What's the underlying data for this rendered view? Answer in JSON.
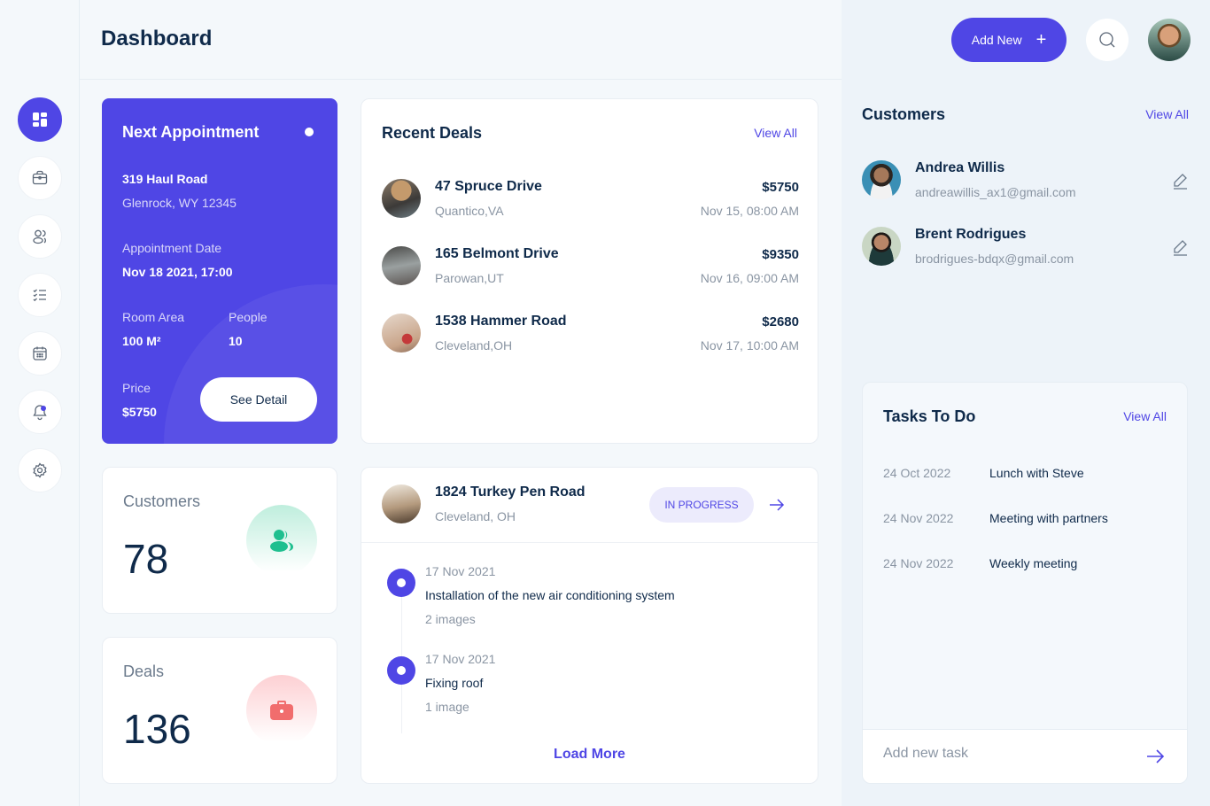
{
  "header": {
    "title": "Dashboard",
    "add_new_label": "Add New"
  },
  "sidebar": {
    "items": [
      {
        "name": "dashboard",
        "icon": "grid-icon",
        "active": true
      },
      {
        "name": "deals",
        "icon": "briefcase-icon",
        "active": false
      },
      {
        "name": "customers",
        "icon": "users-icon",
        "active": false
      },
      {
        "name": "tasks",
        "icon": "checklist-icon",
        "active": false
      },
      {
        "name": "calendar",
        "icon": "calendar-icon",
        "active": false
      },
      {
        "name": "notifications",
        "icon": "bell-icon",
        "active": false,
        "has_badge": true
      },
      {
        "name": "settings",
        "icon": "gear-icon",
        "active": false
      }
    ]
  },
  "appointment": {
    "title": "Next Appointment",
    "address_line1": "319 Haul  Road",
    "address_line2": "Glenrock,  WY  12345",
    "date_label": "Appointment Date",
    "date_value": "Nov 18 2021, 17:00",
    "room_area_label": "Room Area",
    "room_area_value": "100  M²",
    "people_label": "People",
    "people_value": "10",
    "price_label": "Price",
    "price_value": "$5750",
    "button_label": "See Detail"
  },
  "stats": {
    "customers": {
      "label": "Customers",
      "value": "78",
      "icon": "users-icon",
      "color": "#1fbf8f"
    },
    "deals": {
      "label": "Deals",
      "value": "136",
      "icon": "briefcase-icon",
      "color": "#f16d6d"
    }
  },
  "recent_deals": {
    "title": "Recent Deals",
    "view_all": "View All",
    "items": [
      {
        "name": "47 Spruce Drive",
        "location": "Quantico,VA",
        "price": "$5750",
        "date": "Nov 15, 08:00 AM"
      },
      {
        "name": "165 Belmont Drive",
        "location": "Parowan,UT",
        "price": "$9350",
        "date": "Nov 16, 09:00 AM"
      },
      {
        "name": "1538 Hammer Road",
        "location": "Cleveland,OH",
        "price": "$2680",
        "date": "Nov 17, 10:00 AM"
      }
    ]
  },
  "progress": {
    "name": "1824 Turkey Pen Road",
    "location": "Cleveland,  OH",
    "status": "IN PROGRESS",
    "timeline": [
      {
        "date": "17 Nov 2021",
        "text": "Installation of the new air conditioning system",
        "sub": "2  images"
      },
      {
        "date": "17 Nov 2021",
        "text": "Fixing roof",
        "sub": "1  image"
      }
    ],
    "load_more": "Load More"
  },
  "customers": {
    "title": "Customers",
    "view_all": "View All",
    "items": [
      {
        "name": "Andrea  Willis",
        "email": "andreawillis_ax1@gmail.com"
      },
      {
        "name": "Brent  Rodrigues",
        "email": "brodrigues-bdqx@gmail.com"
      }
    ]
  },
  "tasks": {
    "title": "Tasks To Do",
    "view_all": "View All",
    "items": [
      {
        "date": "24 Oct 2022",
        "text": "Lunch with Steve"
      },
      {
        "date": "24 Nov 2022",
        "text": "Meeting with partners"
      },
      {
        "date": "24 Nov 2022",
        "text": "Weekly meeting"
      }
    ],
    "input_placeholder": "Add new task",
    "input_value": ""
  },
  "colors": {
    "accent": "#4f46e5",
    "text_dark": "#0f2a4a",
    "muted": "#8a95a3",
    "green": "#1fbf8f",
    "red": "#f16d6d"
  }
}
